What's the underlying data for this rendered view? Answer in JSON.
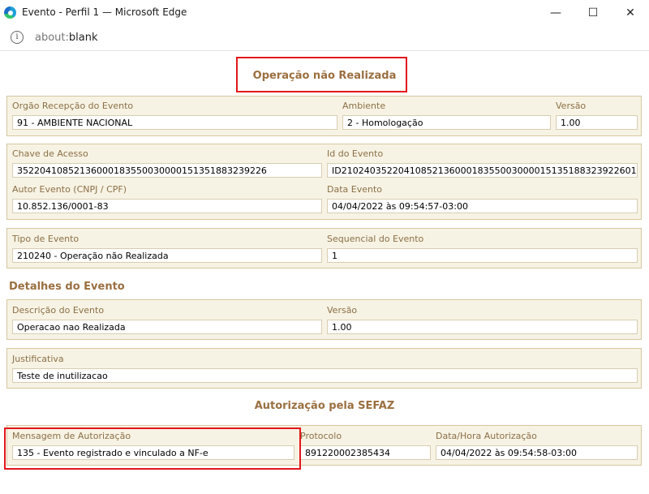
{
  "window": {
    "title": "Evento - Perfil 1 — Microsoft Edge",
    "minimize": "—",
    "maximize": "☐",
    "close": "✕"
  },
  "address": {
    "prefix": "about:",
    "page": "blank"
  },
  "page": {
    "title": "Operação não Realizada",
    "orgao_label": "Orgão Recepção do Evento",
    "orgao_value": "91 - AMBIENTE NACIONAL",
    "ambiente_label": "Ambiente",
    "ambiente_value": "2 - Homologação",
    "versao_label": "Versão",
    "versao_value": "1.00",
    "chave_label": "Chave de Acesso",
    "chave_value": "35220410852136000183550030000151351883239226",
    "id_label": "Id do Evento",
    "id_value": "ID2102403522041085213600018355003000015135188323922601",
    "autor_label": "Autor Evento (CNPJ / CPF)",
    "autor_value": "10.852.136/0001-83",
    "data_label": "Data Evento",
    "data_value": "04/04/2022 às 09:54:57-03:00",
    "tipo_label": "Tipo de Evento",
    "tipo_value": "210240 - Operação não Realizada",
    "seq_label": "Sequencial do Evento",
    "seq_value": "1",
    "detalhes_title": "Detalhes do Evento",
    "descricao_label": "Descrição do Evento",
    "descricao_value": "Operacao nao Realizada",
    "det_versao_label": "Versão",
    "det_versao_value": "1.00",
    "justificativa_label": "Justificativa",
    "justificativa_value": "Teste de inutilizacao",
    "autorizacao_title": "Autorização pela SEFAZ",
    "mensagem_label": "Mensagem de Autorização",
    "mensagem_value": "135 - Evento registrado e vinculado a NF-e",
    "protocolo_label": "Protocolo",
    "protocolo_value": "891220002385434",
    "datahora_label": "Data/Hora Autorização",
    "datahora_value": "04/04/2022 às 09:54:58-03:00"
  },
  "colors": {
    "accent": "#9a6f40",
    "panel_bg": "#f7f3e4",
    "panel_border": "#d6c6a1",
    "highlight": "#e2161b"
  },
  "icons": {
    "browser": "edge-logo-icon",
    "info": "info-icon"
  }
}
